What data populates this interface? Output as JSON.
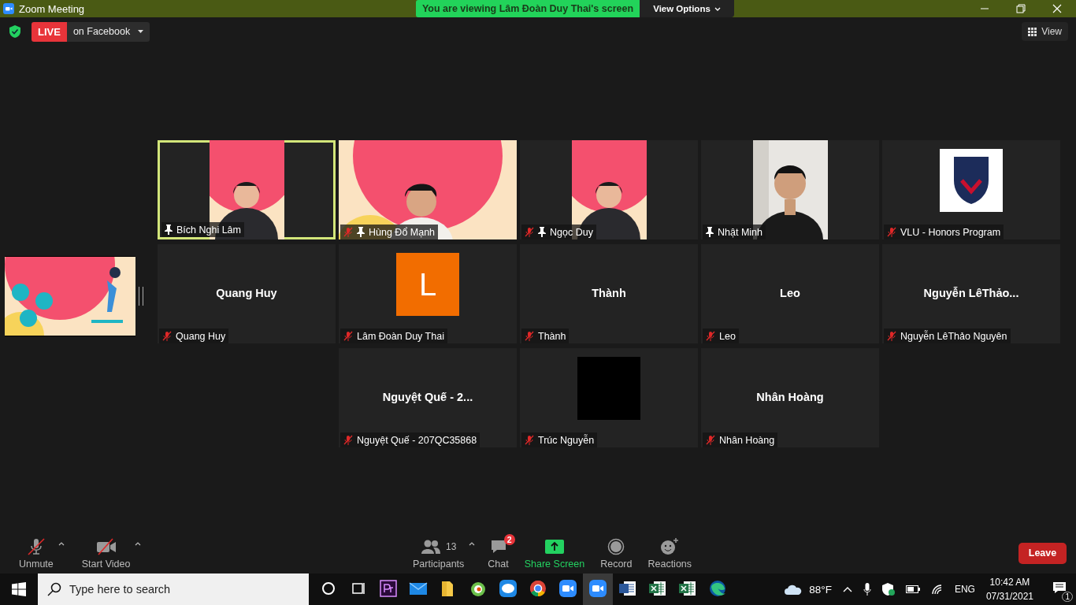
{
  "window": {
    "title": "Zoom Meeting"
  },
  "share_banner": {
    "text": "You are viewing Lâm Đoàn Duy Thai's screen",
    "options": "View Options"
  },
  "live": {
    "badge": "LIVE",
    "platform": "on Facebook"
  },
  "view_button": "View",
  "rows": [
    [
      {
        "name": "Bích Nghi Lâm",
        "muted": false,
        "pinned": true,
        "active": true,
        "kind": "seminar-portrait"
      },
      {
        "name": "Hùng Đổ Mạnh",
        "muted": true,
        "pinned": true,
        "active": false,
        "kind": "seminar-wide"
      },
      {
        "name": "Ngọc Duy",
        "muted": true,
        "pinned": true,
        "active": false,
        "kind": "seminar-portrait"
      },
      {
        "name": "Nhật Minh",
        "muted": false,
        "pinned": true,
        "active": false,
        "kind": "room-portrait"
      },
      {
        "name": "VLU - Honors Program",
        "muted": true,
        "pinned": false,
        "active": false,
        "kind": "logo"
      }
    ],
    [
      {
        "name": "Quang Huy",
        "muted": true,
        "pinned": false,
        "active": false,
        "kind": "name",
        "center": "Quang Huy"
      },
      {
        "name": "Lâm Đoàn Duy Thai",
        "muted": true,
        "pinned": false,
        "active": false,
        "kind": "avatar",
        "center": "L"
      },
      {
        "name": "Thành",
        "muted": true,
        "pinned": false,
        "active": false,
        "kind": "name",
        "center": "Thành"
      },
      {
        "name": "Leo",
        "muted": true,
        "pinned": false,
        "active": false,
        "kind": "name",
        "center": "Leo"
      },
      {
        "name": "Nguyễn  LêThảo Nguyên",
        "muted": true,
        "pinned": false,
        "active": false,
        "kind": "name",
        "center": "Nguyễn  LêThảo..."
      }
    ],
    [
      {
        "name": "Nguyệt Quế - 207QC35868",
        "muted": true,
        "pinned": false,
        "active": false,
        "kind": "name",
        "center": "Nguyệt Quế - 2..."
      },
      {
        "name": "Trúc Nguyễn",
        "muted": true,
        "pinned": false,
        "active": false,
        "kind": "blank"
      },
      {
        "name": "Nhân Hoàng",
        "muted": true,
        "pinned": false,
        "active": false,
        "kind": "name",
        "center": "Nhân Hoàng"
      }
    ]
  ],
  "toolbar": {
    "left": [
      {
        "kind": "mic",
        "label": "Unmute",
        "muted": true,
        "caret": true
      },
      {
        "kind": "camera",
        "label": "Start Video",
        "muted": true,
        "caret": true
      }
    ],
    "center": [
      {
        "kind": "participants",
        "label": "Participants",
        "count": "13",
        "caret": true
      },
      {
        "kind": "chat",
        "label": "Chat",
        "badge": "2",
        "caret": false
      },
      {
        "kind": "share",
        "label": "Share Screen",
        "caret": false
      },
      {
        "kind": "record",
        "label": "Record",
        "caret": false
      },
      {
        "kind": "reactions",
        "label": "Reactions",
        "caret": false
      }
    ],
    "leave": "Leave"
  },
  "taskbar": {
    "search_placeholder": "Type here to search",
    "apps": [
      {
        "kind": "cortana",
        "selected": false
      },
      {
        "kind": "taskview",
        "selected": false
      },
      {
        "kind": "premiere",
        "selected": false
      },
      {
        "kind": "mail",
        "selected": false
      },
      {
        "kind": "folder",
        "selected": false
      },
      {
        "kind": "coccoc",
        "selected": false
      },
      {
        "kind": "zalo",
        "selected": false
      },
      {
        "kind": "chrome",
        "selected": false
      },
      {
        "kind": "zoom",
        "selected": false
      },
      {
        "kind": "zoom",
        "selected": true
      },
      {
        "kind": "word",
        "selected": false
      },
      {
        "kind": "excel",
        "selected": false
      },
      {
        "kind": "excel",
        "selected": false
      },
      {
        "kind": "edge",
        "selected": false
      }
    ],
    "weather": "88°F",
    "language": "ENG",
    "time": "10:42 AM",
    "date": "07/31/2021",
    "notifications": "1"
  }
}
